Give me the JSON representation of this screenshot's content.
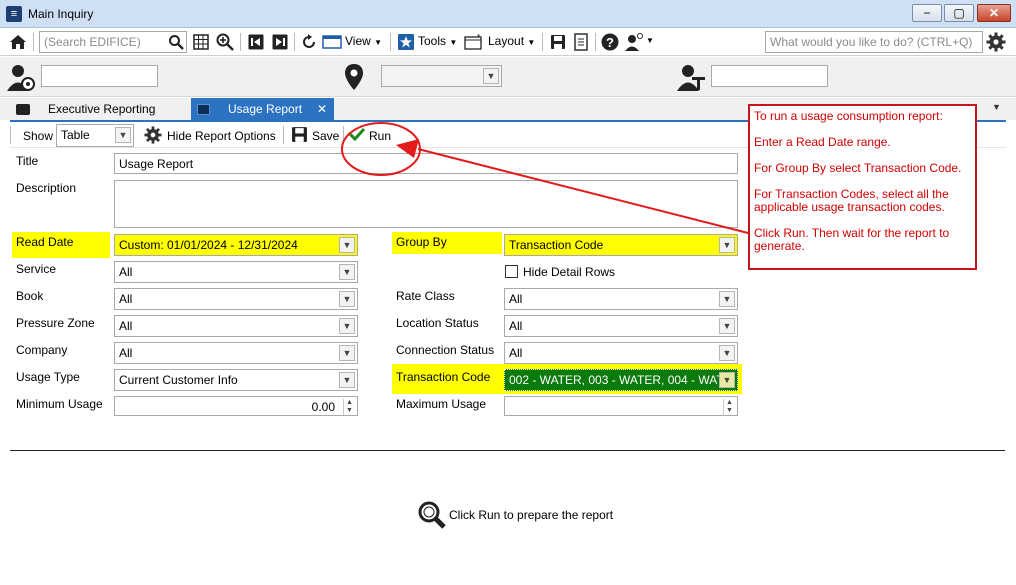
{
  "window": {
    "title": "Main Inquiry",
    "min": "−",
    "max": "▢",
    "close": "✕"
  },
  "toolbar": {
    "search_placeholder": "(Search EDIFICE)",
    "view_label": "View",
    "tools_label": "Tools",
    "layout_label": "Layout",
    "ask_placeholder": "What would you like to do? (CTRL+Q)"
  },
  "tabs": [
    {
      "label": "Executive Reporting"
    },
    {
      "label": "Usage Report",
      "close": "✕"
    }
  ],
  "report_toolbar": {
    "show_label": "Show",
    "show_value": "Table",
    "hide_options_label": "Hide Report Options",
    "save_label": "Save",
    "run_label": "Run"
  },
  "form": {
    "title_label": "Title",
    "title_value": "Usage Report",
    "description_label": "Description",
    "description_value": "",
    "read_date_label": "Read Date",
    "read_date_value": "Custom: 01/01/2024 - 12/31/2024",
    "service_label": "Service",
    "service_value": "All",
    "book_label": "Book",
    "book_value": "All",
    "pressure_zone_label": "Pressure Zone",
    "pressure_zone_value": "All",
    "company_label": "Company",
    "company_value": "All",
    "usage_type_label": "Usage Type",
    "usage_type_value": "Current Customer Info",
    "min_usage_label": "Minimum Usage",
    "min_usage_value": "0.00",
    "group_by_label": "Group By",
    "group_by_value": "Transaction Code",
    "hide_detail_label": "Hide Detail Rows",
    "rate_class_label": "Rate Class",
    "rate_class_value": "All",
    "location_status_label": "Location Status",
    "location_status_value": "All",
    "connection_status_label": "Connection Status",
    "connection_status_value": "All",
    "transaction_code_label": "Transaction Code",
    "transaction_code_value": "002 - WATER, 003 - WATER, 004 - WAT",
    "max_usage_label": "Maximum Usage",
    "max_usage_value": ""
  },
  "callout": {
    "line1": "To run a usage consumption report:",
    "line2": "Enter a Read Date range.",
    "line3": "For Group By select Transaction Code.",
    "line4": "For Transaction Codes, select all the applicable usage transaction codes.",
    "line5": "Click Run.  Then wait for the report to generate."
  },
  "result": {
    "message": "Click Run to prepare the report"
  },
  "colors": {
    "tab_active": "#2b73c2",
    "highlight": "#ffff00",
    "callout_red": "#d10000",
    "selected_green": "#0a7a0a"
  }
}
